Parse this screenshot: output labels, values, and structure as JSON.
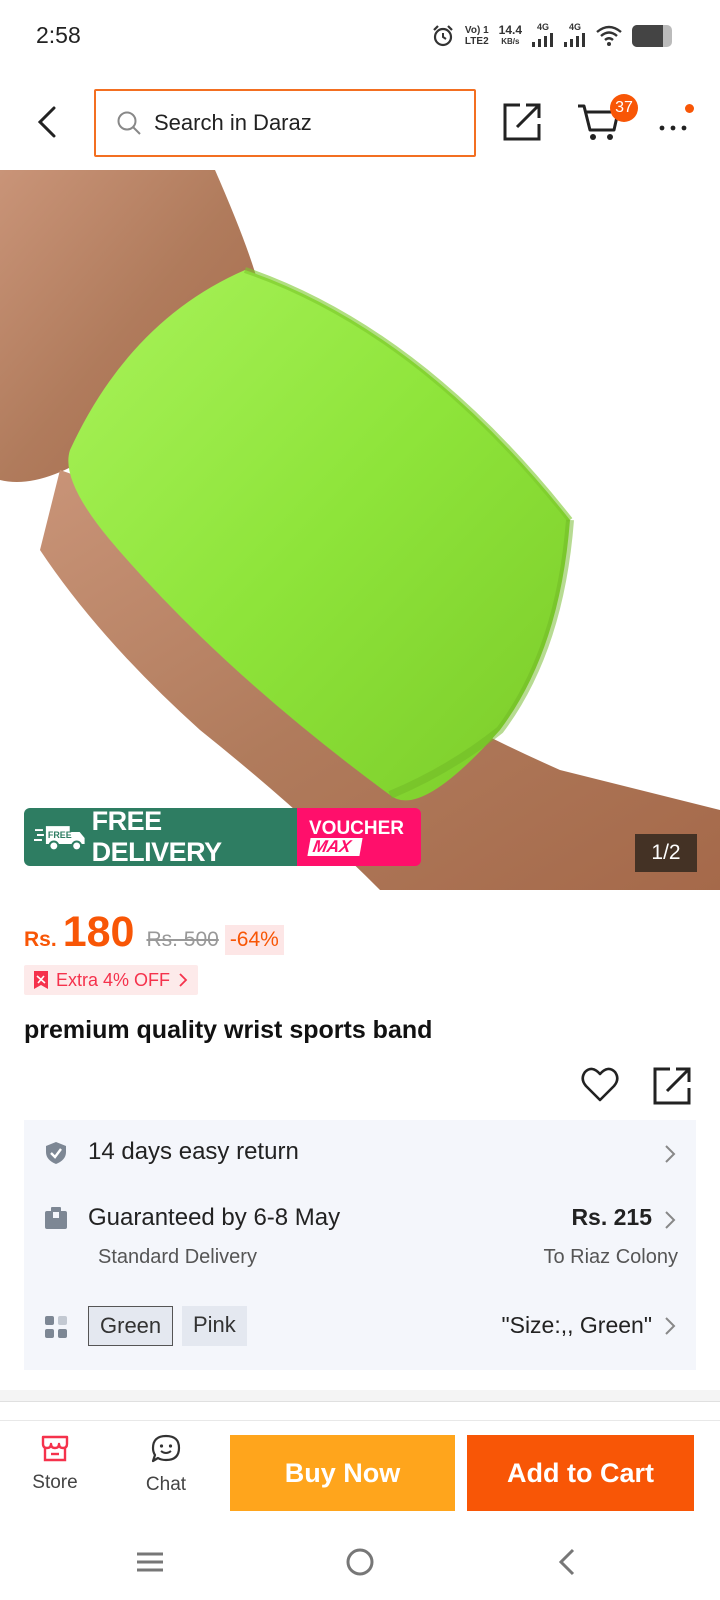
{
  "status_bar": {
    "time": "2:58",
    "volte": "Vo) 1",
    "lte": "LTE2",
    "speed": "14.4",
    "speed_unit": "KB/s",
    "net1": "4G",
    "net2": "4G",
    "battery_level": 0.78
  },
  "header": {
    "search_placeholder": "Search in Daraz",
    "cart_count": "37"
  },
  "gallery": {
    "counter": "1/2",
    "promo_free_badge": "FREE",
    "promo_free_label": "FREE DELIVERY",
    "promo_voucher_line1": "VOUCHER",
    "promo_voucher_line2": "MAX"
  },
  "price": {
    "currency": "Rs.",
    "value": "180",
    "old_price": "Rs. 500",
    "discount": "-64%",
    "extra_offer": "Extra 4% OFF"
  },
  "product": {
    "title": "premium quality wrist sports band"
  },
  "info": {
    "return_text": "14 days easy return",
    "delivery_text": "Guaranteed by 6-8 May",
    "delivery_sub": "Standard Delivery",
    "delivery_price": "Rs. 215",
    "delivery_location": "To Riaz Colony",
    "variants": [
      "Green",
      "Pink"
    ],
    "selected_variant": "\"Size:,, Green\""
  },
  "bottom_bar": {
    "store_label": "Store",
    "chat_label": "Chat",
    "buy_now_label": "Buy Now",
    "add_to_cart_label": "Add to Cart"
  },
  "colors": {
    "accent": "#f85606",
    "buy_now": "#ffa51c",
    "free_delivery": "#2e7d62",
    "voucher": "#ff0f6b"
  }
}
